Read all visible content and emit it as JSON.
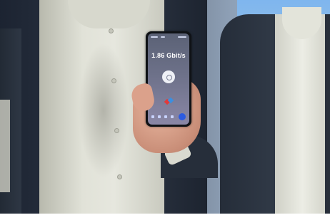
{
  "phone": {
    "speed_label": "1.86 Gbit/s"
  },
  "colors": {
    "jacket": "#252e3c",
    "shirt": "#e1e2d8",
    "sky": "#8fbde8",
    "screen": "#6d7189",
    "accent": "#2c5be0"
  }
}
